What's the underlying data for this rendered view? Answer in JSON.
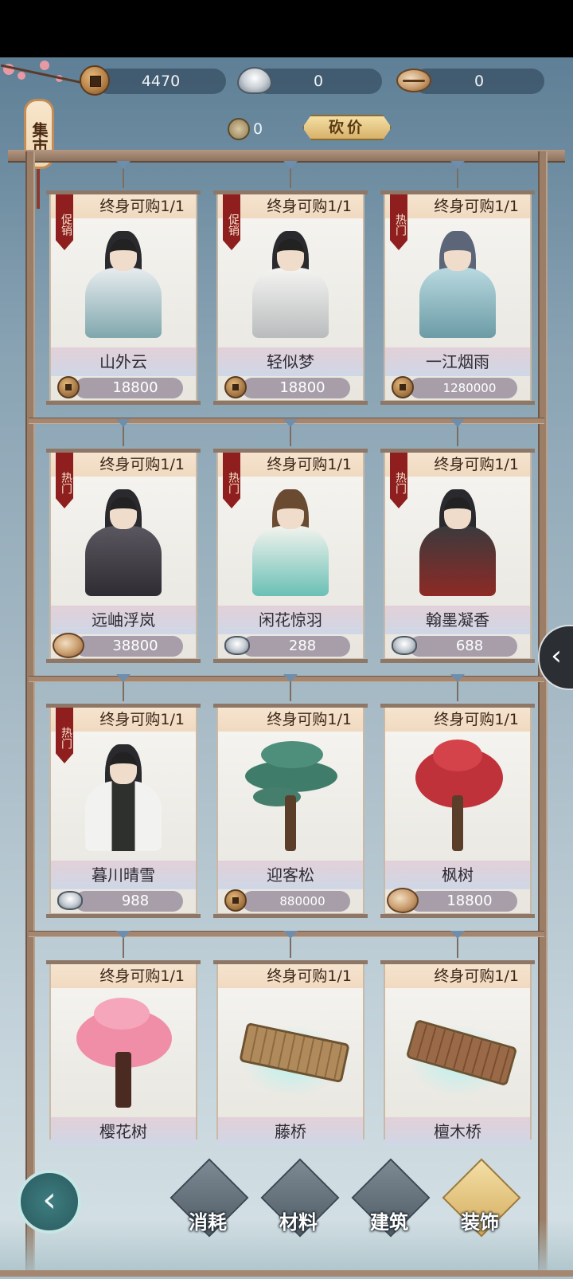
{
  "window": {
    "title": "集市"
  },
  "currency": {
    "copper": "4470",
    "silver": "0",
    "shell": "0"
  },
  "bargain": {
    "token_count": "0",
    "button_label": "砍价"
  },
  "cards": [
    {
      "limit": "终身可购1/1",
      "tag": "促销",
      "name": "山外云",
      "price": "18800",
      "currency_icon": "copper-coin-icon"
    },
    {
      "limit": "终身可购1/1",
      "tag": "促销",
      "name": "轻似梦",
      "price": "18800",
      "currency_icon": "copper-coin-icon"
    },
    {
      "limit": "终身可购1/1",
      "tag": "热门",
      "name": "一江烟雨",
      "price": "1280000",
      "currency_icon": "copper-coin-icon"
    },
    {
      "limit": "终身可购1/1",
      "tag": "热门",
      "name": "远岫浮岚",
      "price": "38800",
      "currency_icon": "shell-icon"
    },
    {
      "limit": "终身可购1/1",
      "tag": "热门",
      "name": "闲花惊羽",
      "price": "288",
      "currency_icon": "silver-ingot-icon"
    },
    {
      "limit": "终身可购1/1",
      "tag": "热门",
      "name": "翰墨凝香",
      "price": "688",
      "currency_icon": "silver-ingot-icon"
    },
    {
      "limit": "终身可购1/1",
      "tag": "热门",
      "name": "暮川晴雪",
      "price": "988",
      "currency_icon": "silver-ingot-icon"
    },
    {
      "limit": "终身可购1/1",
      "tag": "",
      "name": "迎客松",
      "price": "880000",
      "currency_icon": "copper-coin-icon"
    },
    {
      "limit": "终身可购1/1",
      "tag": "",
      "name": "枫树",
      "price": "18800",
      "currency_icon": "shell-icon"
    },
    {
      "limit": "终身可购1/1",
      "tag": "",
      "name": "樱花树",
      "price": "",
      "currency_icon": ""
    },
    {
      "limit": "终身可购1/1",
      "tag": "",
      "name": "藤桥",
      "price": "",
      "currency_icon": ""
    },
    {
      "limit": "终身可购1/1",
      "tag": "",
      "name": "檀木桥",
      "price": "",
      "currency_icon": ""
    }
  ],
  "nav": {
    "consumables": "消耗",
    "materials": "材料",
    "buildings": "建筑",
    "decorations": "装饰",
    "active": "decorations"
  },
  "colors": {
    "promo_tag": "#8e1f1e",
    "price_pill": "#a79eaa",
    "active_nav": "#d3ac5e"
  }
}
